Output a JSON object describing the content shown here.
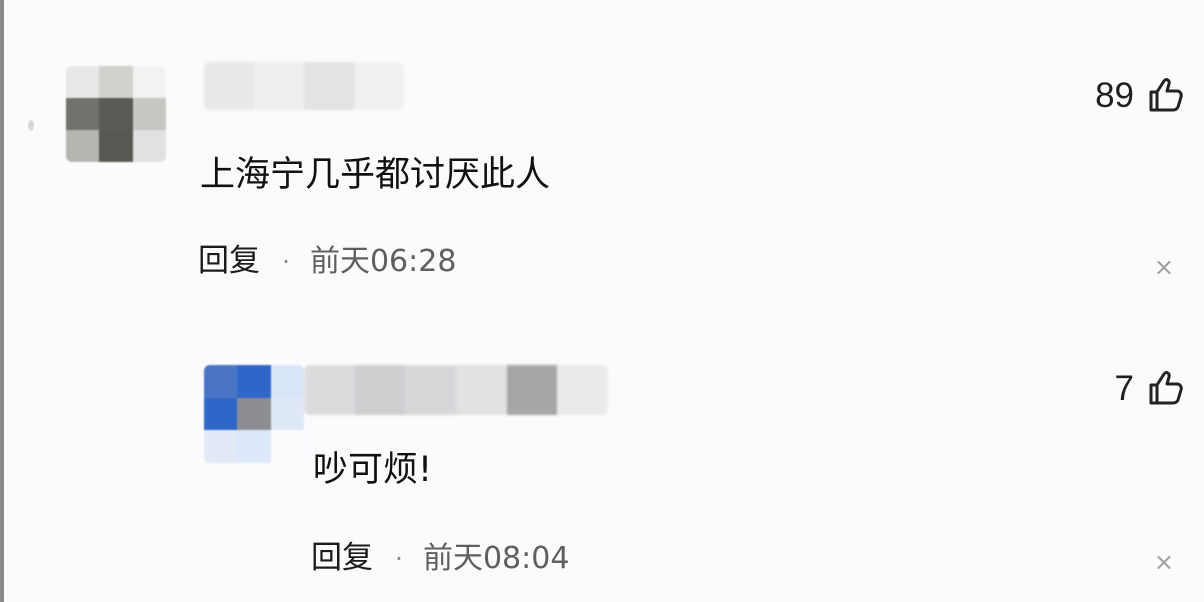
{
  "comments": [
    {
      "like_count": "89",
      "text": "上海宁几乎都讨厌此人",
      "reply_label": "回复",
      "separator": "·",
      "timestamp": "前天06:28",
      "close_symbol": "×"
    },
    {
      "like_count": "7",
      "text": "吵可烦!",
      "reply_label": "回复",
      "separator": "·",
      "timestamp": "前天08:04",
      "close_symbol": "×"
    }
  ],
  "colors": {
    "background": "#fbfbfd",
    "text": "#111111",
    "timestamp": "#5f5f5f",
    "close": "#9e9e9e",
    "reply_avatar_blue": "#2f67c8"
  },
  "icons": {
    "like": "thumb-up-icon",
    "close": "close-icon",
    "avatar": "pixelated-avatar",
    "name": "blurred-username"
  }
}
